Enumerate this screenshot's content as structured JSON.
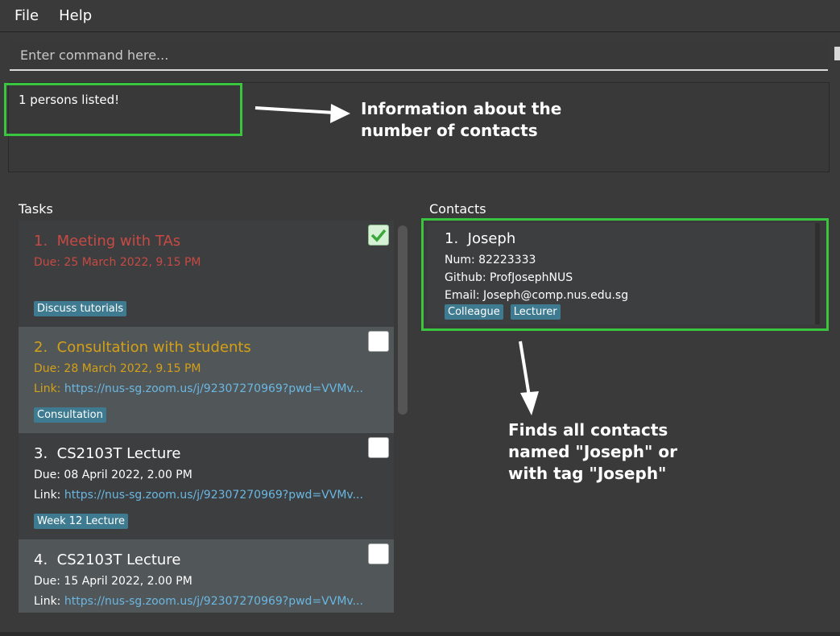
{
  "menu": {
    "file": "File",
    "help": "Help"
  },
  "command": {
    "placeholder": "Enter command here..."
  },
  "result": {
    "text": "1 persons listed!"
  },
  "annotations": {
    "info": "Information about the\nnumber of contacts",
    "finds": "Finds all contacts\nnamed \"Joseph\" or\nwith tag \"Joseph\""
  },
  "tasks_label": "Tasks",
  "contacts_label": "Contacts",
  "tasks": [
    {
      "index": "1.",
      "title": "Meeting with TAs",
      "due": "Due: 25 March 2022, 9.15 PM",
      "link_label": "",
      "link": "",
      "tags": [
        "Discuss tutorials"
      ],
      "color": "#c94a44",
      "done": true
    },
    {
      "index": "2.",
      "title": "Consultation with students",
      "due": "Due: 28 March 2022, 9.15 PM",
      "link_label": "Link:",
      "link": "https://nus-sg.zoom.us/j/92307270969?pwd=VVMv...",
      "tags": [
        "Consultation"
      ],
      "color": "#d4a017",
      "done": false
    },
    {
      "index": "3.",
      "title": "CS2103T Lecture",
      "due": "Due: 08 April 2022, 2.00 PM",
      "link_label": "Link:",
      "link": "https://nus-sg.zoom.us/j/92307270969?pwd=VVMv...",
      "tags": [
        "Week 12 Lecture"
      ],
      "color": "#ffffff",
      "done": false
    },
    {
      "index": "4.",
      "title": "CS2103T Lecture",
      "due": "Due: 15 April 2022, 2.00 PM",
      "link_label": "Link:",
      "link": "https://nus-sg.zoom.us/j/92307270969?pwd=VVMv...",
      "tags": [],
      "color": "#ffffff",
      "done": false
    }
  ],
  "contact": {
    "index": "1.",
    "name": "Joseph",
    "num": "Num: 82223333",
    "github": "Github: ProfJosephNUS",
    "email": "Email: Joseph@comp.nus.edu.sg",
    "tags": [
      "Colleague",
      "Lecturer"
    ]
  },
  "colors": {
    "highlight": "#3ac53e",
    "tag": "#3e7b91",
    "link": "#6ab7e3"
  }
}
